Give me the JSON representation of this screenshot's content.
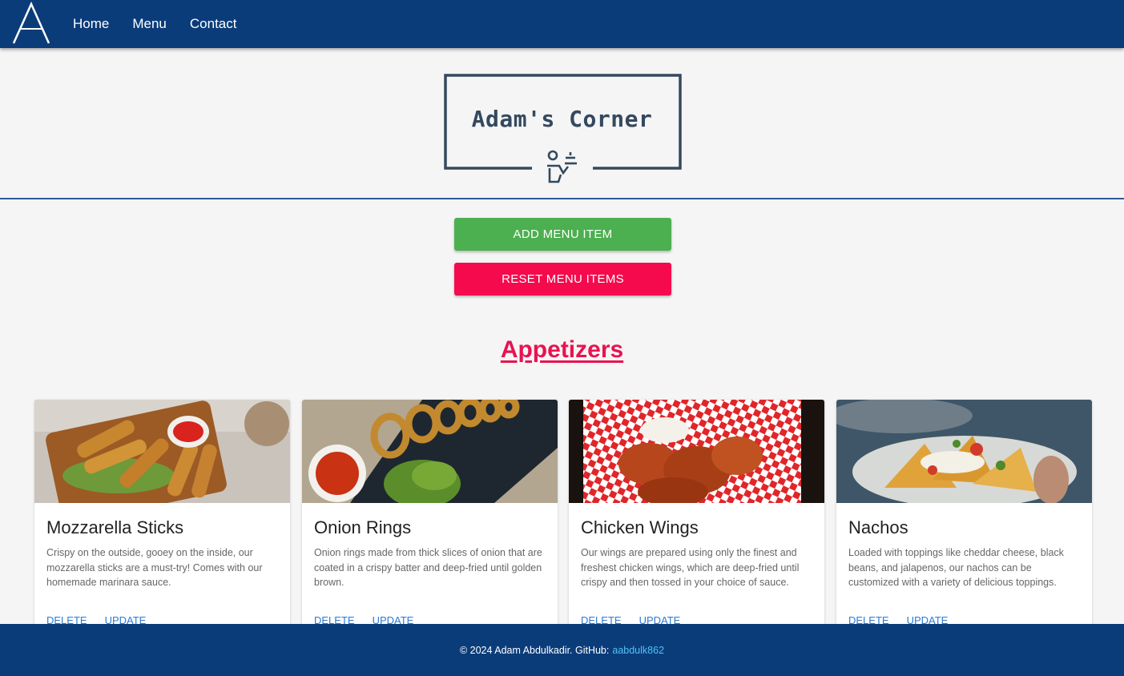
{
  "nav": {
    "brand_letter": "A",
    "links": [
      {
        "label": "Home"
      },
      {
        "label": "Menu"
      },
      {
        "label": "Contact"
      }
    ]
  },
  "logo": {
    "title": "Adam's Corner",
    "icon": "waiter-icon"
  },
  "actions": {
    "add_label": "ADD MENU ITEM",
    "reset_label": "RESET MENU ITEMS"
  },
  "section": {
    "title": "Appetizers"
  },
  "cards": [
    {
      "title": "Mozzarella Sticks",
      "description": "Crispy on the outside, gooey on the inside, our mozzarella sticks are a must-try! Comes with our homemade marinara sauce.",
      "image": "mozzarella-sticks-photo",
      "delete_label": "DELETE",
      "update_label": "UPDATE"
    },
    {
      "title": "Onion Rings",
      "description": "Onion rings made from thick slices of onion that are coated in a crispy batter and deep-fried until golden brown.",
      "image": "onion-rings-photo",
      "delete_label": "DELETE",
      "update_label": "UPDATE"
    },
    {
      "title": "Chicken Wings",
      "description": "Our wings are prepared using only the finest and freshest chicken wings, which are deep-fried until crispy and then tossed in your choice of sauce.",
      "image": "chicken-wings-photo",
      "delete_label": "DELETE",
      "update_label": "UPDATE"
    },
    {
      "title": "Nachos",
      "description": "Loaded with toppings like cheddar cheese, black beans, and jalapenos, our nachos can be customized with a variety of delicious toppings.",
      "image": "nachos-photo",
      "delete_label": "DELETE",
      "update_label": "UPDATE"
    }
  ],
  "footer": {
    "text": "© 2024 Adam Abdulkadir. GitHub:",
    "link": "aabdulk862"
  },
  "colors": {
    "nav_bg": "#0b3c7a",
    "add_button": "#4caf50",
    "reset_button": "#f50a4e",
    "section_title": "#e8134f",
    "link": "#2b7bd6",
    "footer_link": "#4fc3f7"
  }
}
